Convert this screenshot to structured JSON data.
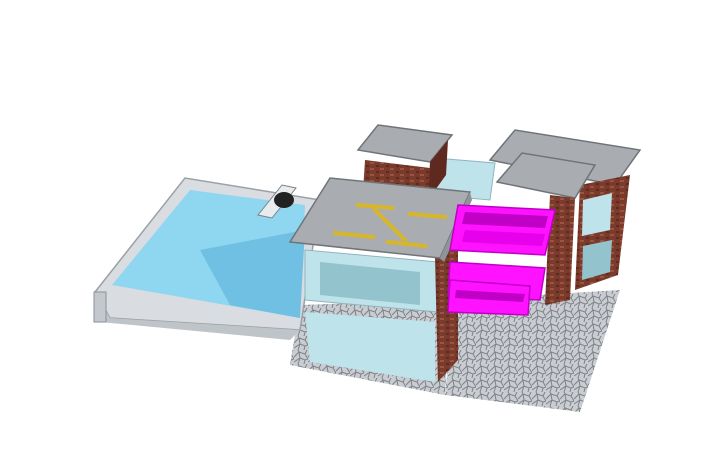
{
  "scene": {
    "subject": "isometric-3d-house-model",
    "elements": [
      "pool",
      "diving-board",
      "house-main-block",
      "chimney",
      "rear-tower",
      "helipad-marking",
      "magenta-shelves",
      "paving-pattern"
    ]
  },
  "colors": {
    "background": "#ffffff",
    "pool_water": "#8fd6f0",
    "pool_water_deep": "#6fc0e2",
    "pool_rim": "#d9dde1",
    "roof": "#a9adb2",
    "roof_dark": "#8f9499",
    "brick": "#7a3b2c",
    "brick_light": "#9a5440",
    "glass": "#bfe3ea",
    "glass_dark": "#93c3cd",
    "helipad": "#d8b62a",
    "magenta": "#ff12ff",
    "magenta_dark": "#c000c6",
    "paving": "#c9ccd1",
    "paving_line": "#7e8389"
  }
}
